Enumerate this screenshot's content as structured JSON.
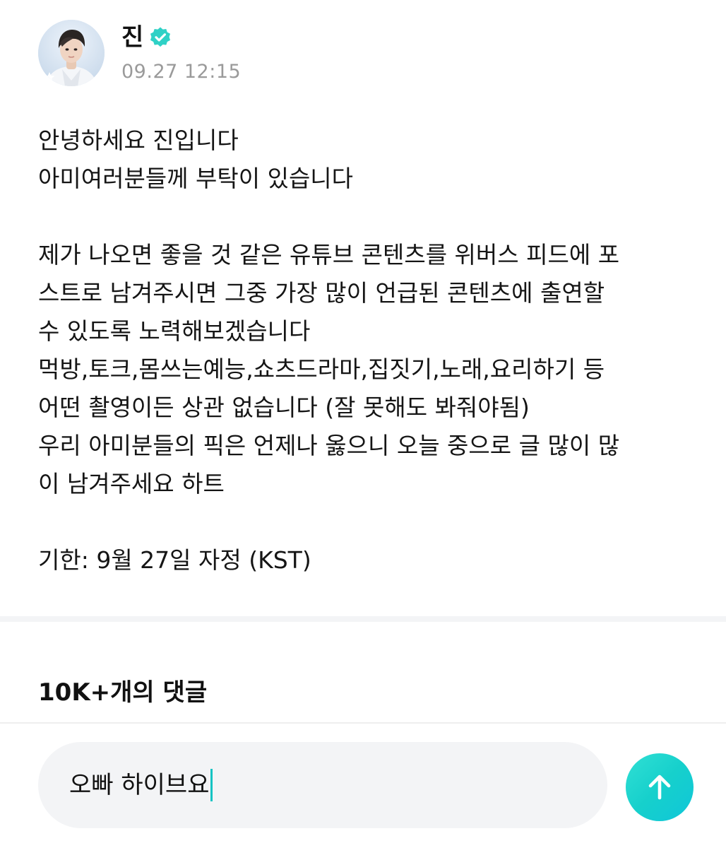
{
  "post": {
    "author_name": "진",
    "timestamp": "09.27 12:15",
    "body_lines": [
      "안녕하세요 진입니다",
      "아미여러분들께 부탁이 있습니다",
      "",
      "제가 나오면 좋을 것 같은 유튜브 콘텐츠를 위버스 피드에 포",
      "스트로 남겨주시면 그중 가장 많이 언급된 콘텐츠에 출연할",
      "수 있도록 노력해보겠습니다",
      "먹방,토크,몸쓰는예능,쇼츠드라마,집짓기,노래,요리하기 등",
      "어떤 촬영이든 상관 없습니다 (잘 못해도 봐줘야됨)",
      "우리 아미분들의 픽은 언제나 옳으니 오늘 중으로 글 많이 많",
      "이 남겨주세요 하트",
      "",
      "기한: 9월 27일 자정 (KST)"
    ]
  },
  "comments": {
    "header": "10K+개의 댓글"
  },
  "composer": {
    "input_value": "오빠 하이브요"
  },
  "icons": {
    "verified": "verified-badge-icon",
    "send": "arrow-up-icon",
    "avatar_star": "star-icon"
  },
  "colors": {
    "accent": "#16d0cc",
    "verified": "#2fd1c6",
    "muted_text": "#9a9a9a",
    "input_bg": "#f3f4f6"
  }
}
